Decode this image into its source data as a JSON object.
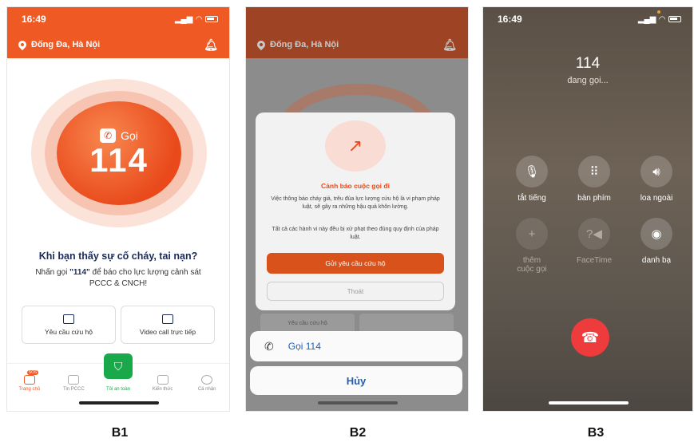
{
  "phone1": {
    "status_time": "16:49",
    "location": "Đống Đa,  Hà Nội",
    "call_label": "Gọi",
    "call_number": "114",
    "headline": "Khi bạn thấy sự cố cháy, tai nạn?",
    "subline_prefix": "Nhấn gọi ",
    "subline_number": "\"114\"",
    "subline_suffix": " để báo cho lực lượng cảnh sát PCCC & CNCH!",
    "quick_rescue": "Yêu cầu cứu hộ",
    "quick_video": "Video call trực tiếp",
    "tabs": [
      "Trang chủ",
      "Tin PCCC",
      "Tôi an toàn",
      "Kiến thức",
      "Cá nhân"
    ],
    "sos_badge": "SOS",
    "accent_color": "#ef5a24"
  },
  "phone2": {
    "location": "Đống Đa,  Hà Nội",
    "dialog_title": "Cảnh báo cuộc gọi đi",
    "dialog_text1": "Việc thông báo cháy giả, trêu đùa lực lượng cứu hộ là vi phạm pháp luật, sẽ gây ra những hậu quả khôn lường.",
    "dialog_text2": "Tất cả các hành vi này đều bị xử phạt theo đúng quy định của pháp luật.",
    "primary_button": "Gửi yêu cầu cứu hộ",
    "secondary_button": "Thoát",
    "dim_quick_left": "Yêu cầu cứu hộ",
    "sheet_call": "Gọi 114",
    "sheet_cancel": "Hủy"
  },
  "phone3": {
    "status_time": "16:49",
    "number": "114",
    "status": "đang gọi...",
    "buttons": {
      "mute": "tắt tiếng",
      "keypad": "bàn phím",
      "speaker": "loa ngoài",
      "add_call": "thêm cuộc gọi",
      "facetime": "FaceTime",
      "contacts": "danh bạ"
    }
  },
  "labels": {
    "b1": "B1",
    "b2": "B2",
    "b3": "B3"
  }
}
